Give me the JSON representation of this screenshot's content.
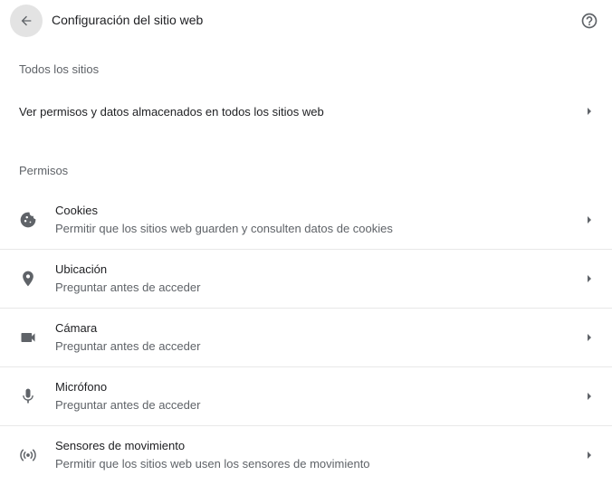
{
  "header": {
    "title": "Configuración del sitio web",
    "back_icon": "arrow-back-icon",
    "help_icon": "help-circle-icon"
  },
  "all_sites": {
    "heading": "Todos los sitios",
    "link_label": "Ver permisos y datos almacenados en todos los sitios web"
  },
  "permissions": {
    "heading": "Permisos",
    "items": [
      {
        "title": "Cookies",
        "description": "Permitir que los sitios web guarden y consulten datos de cookies",
        "icon": "cookie-icon"
      },
      {
        "title": "Ubicación",
        "description": "Preguntar antes de acceder",
        "icon": "location-pin-icon"
      },
      {
        "title": "Cámara",
        "description": "Preguntar antes de acceder",
        "icon": "videocam-icon"
      },
      {
        "title": "Micrófono",
        "description": "Preguntar antes de acceder",
        "icon": "microphone-icon"
      },
      {
        "title": "Sensores de movimiento",
        "description": "Permitir que los sitios web usen los sensores de movimiento",
        "icon": "motion-sensor-icon"
      }
    ]
  },
  "colors": {
    "text_primary": "#202124",
    "text_secondary": "#5f6368",
    "icon": "#5f6368",
    "back_button_bg": "#e3e3e3",
    "divider": "#e8e8e8"
  }
}
